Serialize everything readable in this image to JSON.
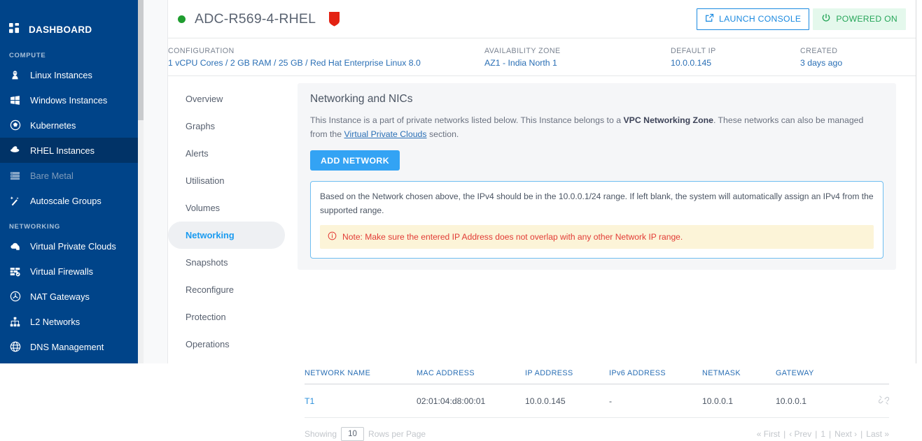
{
  "sidebar": {
    "dashboard_label": "DASHBOARD",
    "sections": [
      {
        "label": "COMPUTE",
        "items": [
          {
            "label": "Linux Instances",
            "icon": "tux-icon",
            "state": "normal"
          },
          {
            "label": "Windows Instances",
            "icon": "windows-icon",
            "state": "normal"
          },
          {
            "label": "Kubernetes",
            "icon": "kubernetes-icon",
            "state": "normal"
          },
          {
            "label": "RHEL Instances",
            "icon": "redhat-icon",
            "state": "active"
          },
          {
            "label": "Bare Metal",
            "icon": "server-icon",
            "state": "disabled"
          },
          {
            "label": "Autoscale Groups",
            "icon": "magic-wand-icon",
            "state": "normal"
          }
        ]
      },
      {
        "label": "NETWORKING",
        "items": [
          {
            "label": "Virtual Private Clouds",
            "icon": "cloud-lock-icon",
            "state": "normal"
          },
          {
            "label": "Virtual Firewalls",
            "icon": "firewall-icon",
            "state": "normal"
          },
          {
            "label": "NAT Gateways",
            "icon": "nat-gateway-icon",
            "state": "normal"
          },
          {
            "label": "L2 Networks",
            "icon": "network-tree-icon",
            "state": "normal"
          },
          {
            "label": "DNS Management",
            "icon": "globe-icon",
            "state": "normal"
          }
        ]
      }
    ]
  },
  "header": {
    "status_dot": "green",
    "instance_name": "ADC-R569-4-RHEL",
    "os_logo": "redhat-shield-icon",
    "launch_console_label": "LAUNCH CONSOLE",
    "power_state_label": "POWERED ON",
    "accent_blue": "#1b8ae0",
    "power_green": "#27a65a"
  },
  "meta": [
    {
      "label": "CONFIGURATION",
      "value": "1 vCPU Cores / 2 GB RAM / 25 GB / Red Hat Enterprise Linux 8.0"
    },
    {
      "label": "AVAILABILITY ZONE",
      "value": "AZ1 - India North 1"
    },
    {
      "label": "DEFAULT IP",
      "value": "10.0.0.145"
    },
    {
      "label": "CREATED",
      "value": "3 days ago"
    }
  ],
  "tabs": [
    {
      "label": "Overview",
      "active": false
    },
    {
      "label": "Graphs",
      "active": false
    },
    {
      "label": "Alerts",
      "active": false
    },
    {
      "label": "Utilisation",
      "active": false
    },
    {
      "label": "Volumes",
      "active": false
    },
    {
      "label": "Networking",
      "active": true
    },
    {
      "label": "Snapshots",
      "active": false
    },
    {
      "label": "Reconfigure",
      "active": false
    },
    {
      "label": "Protection",
      "active": false
    },
    {
      "label": "Operations",
      "active": false
    }
  ],
  "card": {
    "title": "Networking and NICs",
    "desc_part1": "This Instance is a part of private networks listed below. This Instance belongs to a ",
    "desc_bold": "VPC Networking Zone",
    "desc_part2": ". These networks can also be managed from the ",
    "desc_link": "Virtual Private Clouds",
    "desc_part3": " section.",
    "add_network_label": "ADD NETWORK",
    "info_text": "Based on the Network chosen above, the IPv4 should be in the 10.0.0.1/24 range. If left blank, the system will automatically assign an IPv4 from the supported range.",
    "note_icon": "info-circle-icon",
    "note_text": "Note: Make sure the entered IP Address does not overlap with any other Network IP range."
  },
  "table": {
    "columns": [
      "NETWORK NAME",
      "MAC ADDRESS",
      "IP ADDRESS",
      "IPv6 ADDRESS",
      "NETMASK",
      "GATEWAY",
      ""
    ],
    "rows": [
      {
        "network_name": "T1",
        "mac_address": "02:01:04:d8:00:01",
        "ip_address": "10.0.0.145",
        "ipv6_address": "-",
        "netmask": "10.0.0.1",
        "gateway": "10.0.0.1",
        "action_icon": "unlink-icon"
      }
    ]
  },
  "footer": {
    "showing_label": "Showing",
    "rows_per_page_value": "10",
    "rows_per_page_label": "Rows per Page",
    "first": "« First",
    "prev": "‹ Prev",
    "page": "1",
    "next": "Next ›",
    "last": "Last »",
    "sep": "|"
  }
}
